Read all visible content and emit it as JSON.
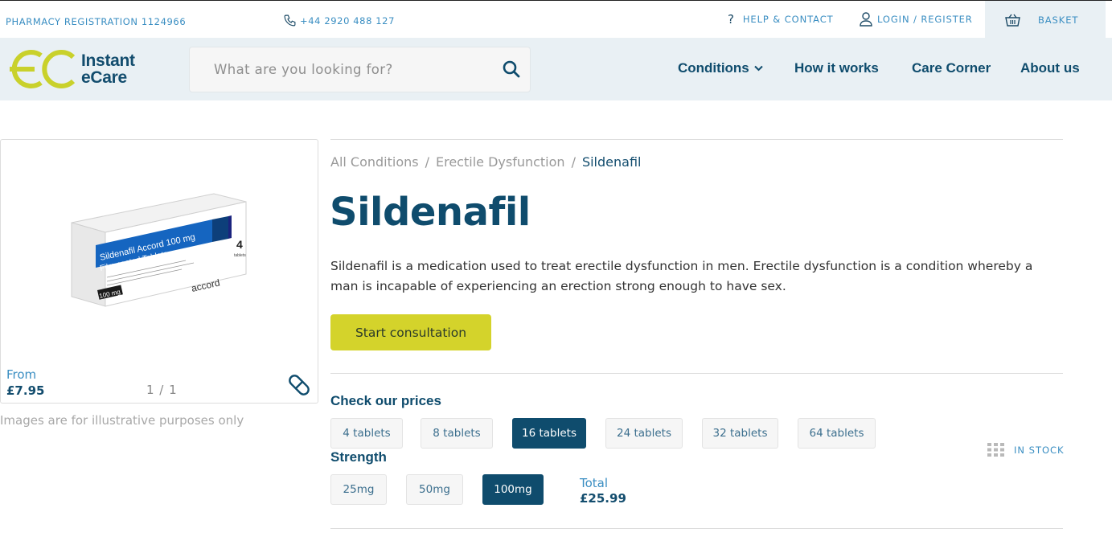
{
  "topbar": {
    "registration": "PHARMACY REGISTRATION 1124966",
    "phone": "+44 2920 488 127",
    "help_icon": "?",
    "help": "HELP & CONTACT",
    "login": "LOGIN / REGISTER",
    "basket": "BASKET"
  },
  "logo": {
    "line1": "Instant",
    "line2": "eCare"
  },
  "search": {
    "placeholder": "What are you looking for?"
  },
  "nav": {
    "conditions": "Conditions",
    "how": "How it works",
    "care": "Care Corner",
    "about": "About us"
  },
  "product_card": {
    "from_label": "From",
    "from_price": "£7.95",
    "counter": "1 / 1",
    "disclaimer": "Images are for illustrative purposes only",
    "pack": {
      "name": "Sildenafil Accord 100 mg",
      "form": "Film coated Tablets",
      "strength_badge": "100 mg",
      "count": "4",
      "count_label": "tablets",
      "brand": "accord"
    }
  },
  "breadcrumb": [
    "All Conditions",
    "/",
    "Erectile Dysfunction",
    "/",
    "Sildenafil"
  ],
  "product": {
    "title": "Sildenafil",
    "description": "Sildenafil is a medication used to treat erectile dysfunction in men. Erectile dysfunction is a condition whereby a man is incapable of experiencing an erection strong enough to have sex.",
    "cta": "Start consultation"
  },
  "prices": {
    "heading": "Check our prices",
    "quantities": [
      "4 tablets",
      "8 tablets",
      "16 tablets",
      "24 tablets",
      "32 tablets",
      "64 tablets"
    ],
    "selected_quantity": "16 tablets",
    "stock": "IN STOCK",
    "strength_heading": "Strength",
    "strengths": [
      "25mg",
      "50mg",
      "100mg"
    ],
    "selected_strength": "100mg",
    "total_label": "Total",
    "total_value": "£25.99"
  },
  "colors": {
    "brand_navy": "#0f4c6d",
    "accent_lime": "#d4d32b",
    "link_blue": "#3a8ec2",
    "header_bg": "#e9f0f4"
  }
}
